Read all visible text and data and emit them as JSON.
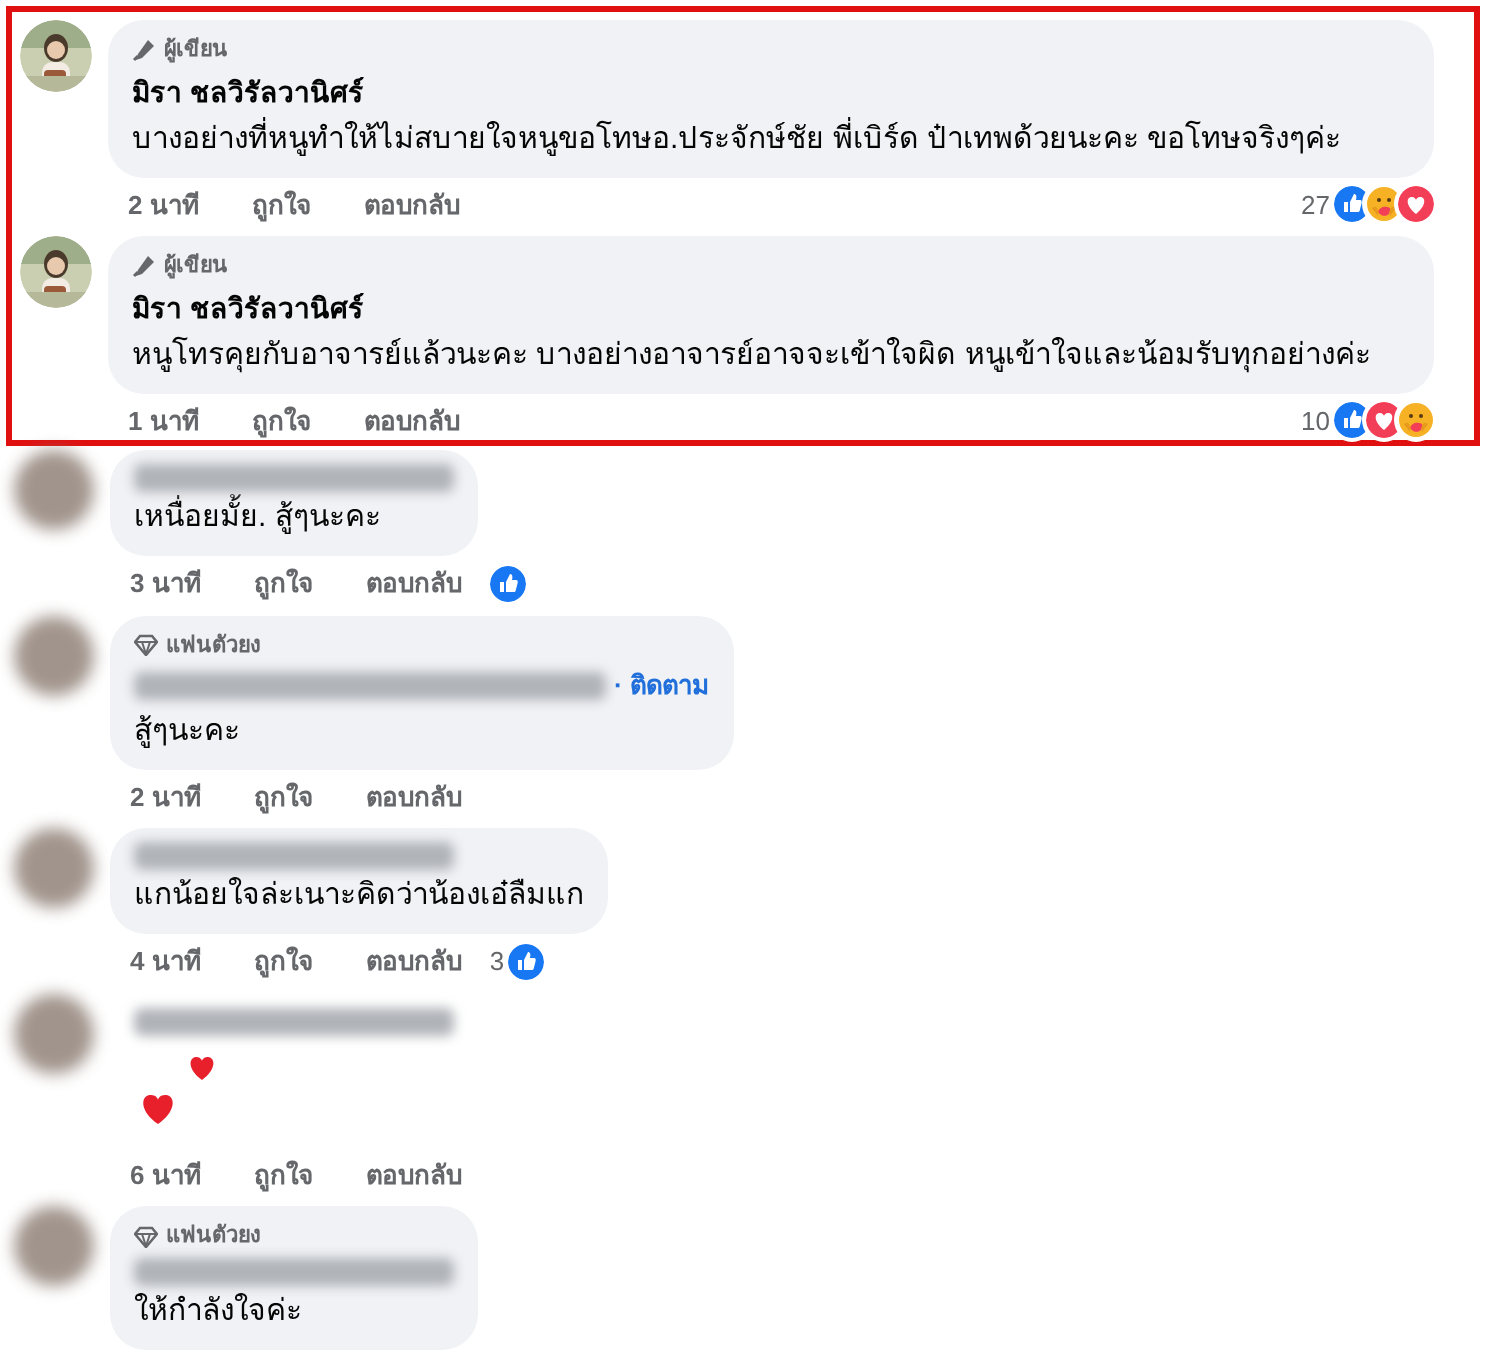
{
  "highlighted_comments": [
    {
      "badge": {
        "kind": "author",
        "label": "ผู้เขียน"
      },
      "name": "มิรา ชลวิรัลวานิศร์",
      "body": "บางอย่างที่หนูทำให้ไม่สบายใจหนูขอโทษอ.ประจักษ์ชัย พี่เบิร์ด ป๋าเทพด้วยนะคะ ขอโทษจริงๆค่ะ",
      "time": "2 นาที",
      "like": "ถูกใจ",
      "reply": "ตอบกลับ",
      "reaction_count": "27",
      "reactions": [
        {
          "kind": "like"
        },
        {
          "kind": "care"
        },
        {
          "kind": "love"
        }
      ]
    },
    {
      "badge": {
        "kind": "author",
        "label": "ผู้เขียน"
      },
      "name": "มิรา ชลวิรัลวานิศร์",
      "body": "หนูโทรคุยกับอาจารย์แล้วนะคะ บางอย่างอาจารย์อาจจะเข้าใจผิด หนูเข้าใจและน้อมรับทุกอย่างค่ะ",
      "time": "1 นาที",
      "like": "ถูกใจ",
      "reply": "ตอบกลับ",
      "reaction_count": "10",
      "reactions": [
        {
          "kind": "like"
        },
        {
          "kind": "love"
        },
        {
          "kind": "care"
        }
      ]
    }
  ],
  "comments": [
    {
      "avatar": {
        "kind": "blurred"
      },
      "bubble": true,
      "body": "เหนื่อยมั้ย. สู้ๆนะคะ",
      "time": "3 นาที",
      "like": "ถูกใจ",
      "reply": "ตอบกลับ",
      "reactions": [
        {
          "kind": "like"
        }
      ]
    },
    {
      "avatar": {
        "kind": "blurred"
      },
      "bubble": true,
      "badge": {
        "kind": "fan",
        "label": "แฟนตัวยง"
      },
      "follow": "· ติดตาม",
      "body": "สู้ๆนะคะ",
      "time": "2 นาที",
      "like": "ถูกใจ",
      "reply": "ตอบกลับ"
    },
    {
      "avatar": {
        "kind": "blurred"
      },
      "bubble": true,
      "body": "แกน้อยใจล่ะเนาะคิดว่าน้องเอ๋ลืมแก",
      "time": "4 นาที",
      "like": "ถูกใจ",
      "reply": "ตอบกลับ",
      "reaction_count": "3",
      "reactions": [
        {
          "kind": "like"
        }
      ]
    },
    {
      "avatar": {
        "kind": "blurred"
      },
      "bubble": false,
      "sticker": {
        "kind": "hearts"
      },
      "time": "6 นาที",
      "like": "ถูกใจ",
      "reply": "ตอบกลับ"
    },
    {
      "avatar": {
        "kind": "blurred"
      },
      "bubble": true,
      "badge": {
        "kind": "fan",
        "label": "แฟนตัวยง"
      },
      "body": "ให้กำลังใจค่ะ"
    }
  ]
}
